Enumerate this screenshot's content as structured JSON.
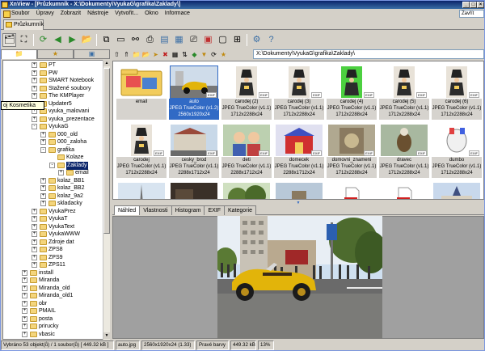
{
  "window": {
    "title": "XnView - [Průzkumník - X:\\Dokumenty\\VyukaG\\grafika\\Zaklady\\]"
  },
  "menu": {
    "items": [
      "Soubor",
      "Úpravy",
      "Zobrazit",
      "Nástroje",
      "Vytvořit...",
      "Okno",
      "Informace"
    ],
    "combo_value": "Zavřít"
  },
  "tabs": [
    {
      "label": "Průzkumník"
    }
  ],
  "toolbar_icons": [
    "browser-icon",
    "fullscreen-icon",
    "refresh-icon",
    "back-icon",
    "forward-icon",
    "open-folder-icon",
    "copy-icon",
    "new-window-icon",
    "binoculars-icon",
    "print-icon",
    "image-list-icon",
    "filmstrip-icon",
    "scanner-icon",
    "slideshow-icon",
    "screen-icon",
    "table-icon",
    "settings-icon",
    "help-icon"
  ],
  "path": {
    "value": "X:\\Dokumenty\\VyukaG\\grafika\\Zaklady\\"
  },
  "tooltip": "oj Kosmetika",
  "tree": [
    {
      "label": "PT",
      "level": 0,
      "pm": "+"
    },
    {
      "label": "PW",
      "level": 0,
      "pm": "+"
    },
    {
      "label": "SMART Notebook",
      "level": 0,
      "pm": "+"
    },
    {
      "label": "Stažené soubory",
      "level": 0,
      "pm": "+"
    },
    {
      "label": "The KMPlayer",
      "level": 0,
      "pm": "+"
    },
    {
      "label": "Updater5",
      "level": 0,
      "pm": "+"
    },
    {
      "label": "vyuka_malovani",
      "level": 0,
      "pm": "+"
    },
    {
      "label": "vyuka_prezentace",
      "level": 0,
      "pm": "+"
    },
    {
      "label": "VyukaG",
      "level": 0,
      "pm": "-"
    },
    {
      "label": "000_old",
      "level": 1,
      "pm": "+"
    },
    {
      "label": "000_zaloha",
      "level": 1,
      "pm": "+"
    },
    {
      "label": "grafika",
      "level": 1,
      "pm": "-"
    },
    {
      "label": "Kolaze",
      "level": 2,
      "pm": ""
    },
    {
      "label": "Zaklady",
      "level": 2,
      "pm": "-",
      "selected": true
    },
    {
      "label": "email",
      "level": 3,
      "pm": "+"
    },
    {
      "label": "kolaz_BB1",
      "level": 1,
      "pm": "+"
    },
    {
      "label": "kolaz_BB2",
      "level": 1,
      "pm": "+"
    },
    {
      "label": "kolaz_9a2",
      "level": 1,
      "pm": "+"
    },
    {
      "label": "skladacky",
      "level": 1,
      "pm": "+"
    },
    {
      "label": "VyukaPrez",
      "level": 0,
      "pm": "+"
    },
    {
      "label": "VyukaT",
      "level": 0,
      "pm": "+"
    },
    {
      "label": "VyukaText",
      "level": 0,
      "pm": "+"
    },
    {
      "label": "VyukaWWW",
      "level": 0,
      "pm": "+"
    },
    {
      "label": "Zdroje dat",
      "level": 0,
      "pm": "+"
    },
    {
      "label": "ZPS8",
      "level": 0,
      "pm": "+"
    },
    {
      "label": "ZPS9",
      "level": 0,
      "pm": "+"
    },
    {
      "label": "ZPS11",
      "level": 0,
      "pm": "+"
    },
    {
      "label": "install",
      "level": -1,
      "pm": "+"
    },
    {
      "label": "Miranda",
      "level": -1,
      "pm": "+"
    },
    {
      "label": "Miranda_old",
      "level": -1,
      "pm": "+"
    },
    {
      "label": "Miranda_old1",
      "level": -1,
      "pm": "+"
    },
    {
      "label": "obr",
      "level": -1,
      "pm": "+"
    },
    {
      "label": "PMAIL",
      "level": -1,
      "pm": "+"
    },
    {
      "label": "posta",
      "level": -1,
      "pm": "+"
    },
    {
      "label": "prirucky",
      "level": -1,
      "pm": "+"
    },
    {
      "label": "vbasic",
      "level": -1,
      "pm": "+"
    }
  ],
  "thumbnails": [
    {
      "name": "email",
      "line2": "",
      "line3": "",
      "kind": "folder",
      "exif": false
    },
    {
      "name": "auto",
      "line2": "JPEG TrueColor (v1.2)",
      "line3": "2560x1920x24",
      "kind": "car",
      "exif": true,
      "selected": true
    },
    {
      "name": "carodej (2)",
      "line2": "JPEG TrueColor (v1.1)",
      "line3": "1712x2288x24",
      "kind": "wizard",
      "exif": true
    },
    {
      "name": "carodej (3)",
      "line2": "JPEG TrueColor (v1.1)",
      "line3": "1712x2288x24",
      "kind": "wizard",
      "exif": true
    },
    {
      "name": "carodej (4)",
      "line2": "JPEG TrueColor (v1.1)",
      "line3": "1712x2288x24",
      "kind": "wizard-green",
      "exif": true
    },
    {
      "name": "carodej (5)",
      "line2": "JPEG TrueColor (v1.1)",
      "line3": "1712x2288x24",
      "kind": "wizard",
      "exif": true
    },
    {
      "name": "carodej (6)",
      "line2": "JPEG TrueColor (v1.1)",
      "line3": "1712x2288x24",
      "kind": "wizard",
      "exif": true
    },
    {
      "name": "carodej",
      "line2": "JPEG TrueColor (v1.1)",
      "line3": "1712x2288x24",
      "kind": "wizard",
      "exif": true
    },
    {
      "name": "cesky_brod",
      "line2": "JPEG TrueColor (v1.1)",
      "line3": "2288x1712x24",
      "kind": "town",
      "exif": true
    },
    {
      "name": "deti",
      "line2": "JPEG TrueColor (v1.1)",
      "line3": "2288x1712x24",
      "kind": "kids",
      "exif": true
    },
    {
      "name": "domecek",
      "line2": "JPEG TrueColor (v1.1)",
      "line3": "2288x1712x24",
      "kind": "house",
      "exif": true
    },
    {
      "name": "domovni_znameni",
      "line2": "JPEG TrueColor (v1.1)",
      "line3": "1712x2288x24",
      "kind": "sign",
      "exif": true
    },
    {
      "name": "dravec",
      "line2": "JPEG TrueColor (v1.1)",
      "line3": "1712x2288x24",
      "kind": "bird",
      "exif": true
    },
    {
      "name": "dumbo",
      "line2": "JPEG TrueColor (v1.1)",
      "line3": "1712x2288x24",
      "kind": "dumbo",
      "exif": true
    },
    {
      "name": "",
      "line2": "",
      "line3": "",
      "kind": "tower",
      "exif": false
    },
    {
      "name": "",
      "line2": "",
      "line3": "",
      "kind": "dark",
      "exif": false
    },
    {
      "name": "",
      "line2": "",
      "line3": "",
      "kind": "trees",
      "exif": false
    },
    {
      "name": "",
      "line2": "",
      "line3": "",
      "kind": "outdoor",
      "exif": false
    },
    {
      "name": "",
      "line2": "",
      "line3": "",
      "kind": "pdf",
      "exif": false
    },
    {
      "name": "",
      "line2": "",
      "line3": "",
      "kind": "pdf",
      "exif": false
    },
    {
      "name": "",
      "line2": "",
      "line3": "",
      "kind": "castle",
      "exif": false
    }
  ],
  "preview_tabs": [
    {
      "label": "Náhled",
      "selected": true
    },
    {
      "label": "Vlastnosti"
    },
    {
      "label": "Histogram"
    },
    {
      "label": "EXIF"
    },
    {
      "label": "Kategorie"
    }
  ],
  "status": {
    "selection": "Vybráno 53 objekt(ů) / 1 soubor(ů) [ 449.32 kB ]",
    "filename": "auto.jpg",
    "dimensions": "2560x1920x24 (1.33)",
    "colors": "Pravé barvy",
    "size": "449.32 kB",
    "zoom": "13%"
  }
}
